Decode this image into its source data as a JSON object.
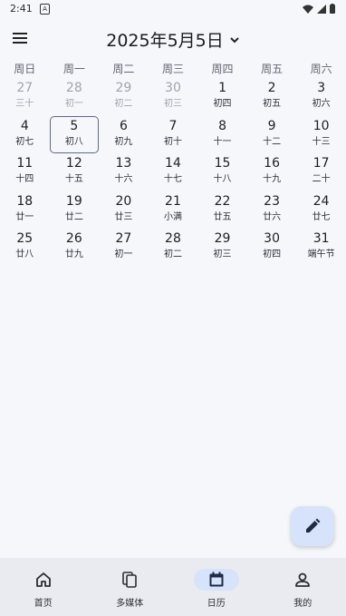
{
  "status": {
    "time": "2:41",
    "notif": "A"
  },
  "header": {
    "title": "2025年5月5日"
  },
  "weekdays": [
    "周日",
    "周一",
    "周二",
    "周三",
    "周四",
    "周五",
    "周六"
  ],
  "days": [
    {
      "d": "27",
      "l": "三十",
      "out": true
    },
    {
      "d": "28",
      "l": "初一",
      "out": true
    },
    {
      "d": "29",
      "l": "初二",
      "out": true
    },
    {
      "d": "30",
      "l": "初三",
      "out": true
    },
    {
      "d": "1",
      "l": "初四"
    },
    {
      "d": "2",
      "l": "初五"
    },
    {
      "d": "3",
      "l": "初六"
    },
    {
      "d": "4",
      "l": "初七"
    },
    {
      "d": "5",
      "l": "初八",
      "selected": true
    },
    {
      "d": "6",
      "l": "初九"
    },
    {
      "d": "7",
      "l": "初十"
    },
    {
      "d": "8",
      "l": "十一"
    },
    {
      "d": "9",
      "l": "十二"
    },
    {
      "d": "10",
      "l": "十三"
    },
    {
      "d": "11",
      "l": "十四"
    },
    {
      "d": "12",
      "l": "十五"
    },
    {
      "d": "13",
      "l": "十六"
    },
    {
      "d": "14",
      "l": "十七"
    },
    {
      "d": "15",
      "l": "十八"
    },
    {
      "d": "16",
      "l": "十九"
    },
    {
      "d": "17",
      "l": "二十"
    },
    {
      "d": "18",
      "l": "廿一"
    },
    {
      "d": "19",
      "l": "廿二"
    },
    {
      "d": "20",
      "l": "廿三"
    },
    {
      "d": "21",
      "l": "小满"
    },
    {
      "d": "22",
      "l": "廿五"
    },
    {
      "d": "23",
      "l": "廿六"
    },
    {
      "d": "24",
      "l": "廿七"
    },
    {
      "d": "25",
      "l": "廿八"
    },
    {
      "d": "26",
      "l": "廿九"
    },
    {
      "d": "27",
      "l": "初一"
    },
    {
      "d": "28",
      "l": "初二"
    },
    {
      "d": "29",
      "l": "初三"
    },
    {
      "d": "30",
      "l": "初四"
    },
    {
      "d": "31",
      "l": "端午节"
    }
  ],
  "nav": [
    {
      "label": "首页",
      "icon": "home-icon"
    },
    {
      "label": "多媒体",
      "icon": "media-icon"
    },
    {
      "label": "日历",
      "icon": "calendar-icon",
      "active": true
    },
    {
      "label": "我的",
      "icon": "person-icon"
    }
  ],
  "colors": {
    "accent": "#d7e2fb",
    "selected_border": "#5a6b85",
    "background": "#f6f7fb",
    "nav_bg": "#eaebf1"
  }
}
